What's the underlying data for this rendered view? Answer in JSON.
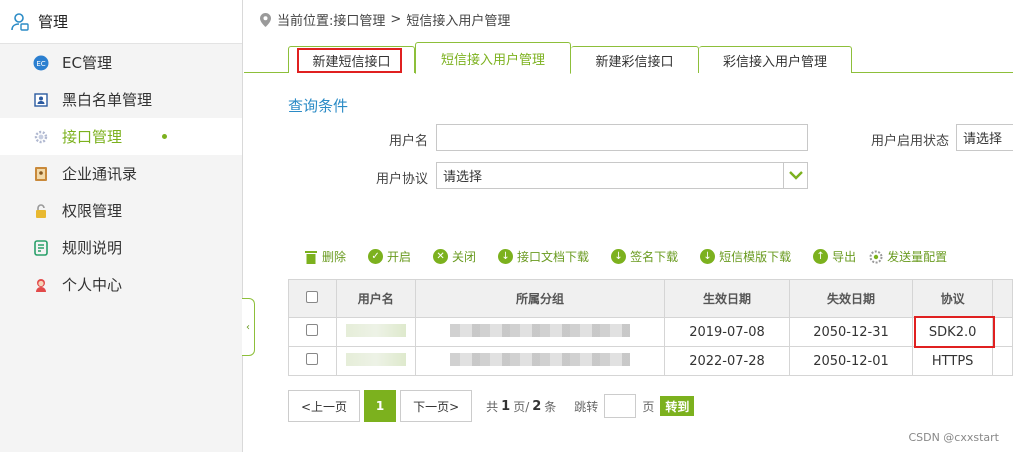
{
  "sidebar": {
    "header": "管理",
    "items": [
      {
        "label": "EC管理",
        "icon": "ec-icon"
      },
      {
        "label": "黑白名单管理",
        "icon": "id-card-icon"
      },
      {
        "label": "接口管理",
        "icon": "gear-icon",
        "active": true
      },
      {
        "label": "企业通讯录",
        "icon": "address-book-icon"
      },
      {
        "label": "权限管理",
        "icon": "lock-icon"
      },
      {
        "label": "规则说明",
        "icon": "document-icon"
      },
      {
        "label": "个人中心",
        "icon": "user-icon"
      }
    ],
    "collapse_glyph": "‹"
  },
  "breadcrumb": {
    "prefix": "当前位置:",
    "path1": "接口管理",
    "sep": ">",
    "path2": "短信接入用户管理"
  },
  "tabs": [
    "新建短信接口",
    "短信接入用户管理",
    "新建彩信接口",
    "彩信接入用户管理"
  ],
  "query": {
    "title": "查询条件",
    "username_label": "用户名",
    "username_value": "",
    "protocol_label": "用户协议",
    "protocol_value": "请选择",
    "status_label": "用户启用状态",
    "status_value": "请选择"
  },
  "toolbar": {
    "delete": "删除",
    "enable": "开启",
    "disable": "关闭",
    "doc_download": "接口文档下载",
    "sign_download": "签名下载",
    "template_download": "短信模版下载",
    "export": "导出",
    "send_config": "发送量配置"
  },
  "table": {
    "headers": [
      "用户名",
      "所属分组",
      "生效日期",
      "失效日期",
      "协议"
    ],
    "rows": [
      {
        "start": "2019-07-08",
        "end": "2050-12-31",
        "protocol": "SDK2.0"
      },
      {
        "start": "2022-07-28",
        "end": "2050-12-01",
        "protocol": "HTTPS"
      }
    ]
  },
  "pager": {
    "prev": "<上一页",
    "current": "1",
    "next": "下一页>",
    "total_prefix": "共",
    "total_pages": "1",
    "page_mid": "页/",
    "total_items": "2",
    "items_suffix": "条",
    "jump": "跳转",
    "page_unit": "页",
    "go": "转到"
  },
  "watermark": "CSDN @cxxstart",
  "colors": {
    "accent": "#7cb11e",
    "link": "#2b8bc6",
    "highlight": "#e02020"
  }
}
